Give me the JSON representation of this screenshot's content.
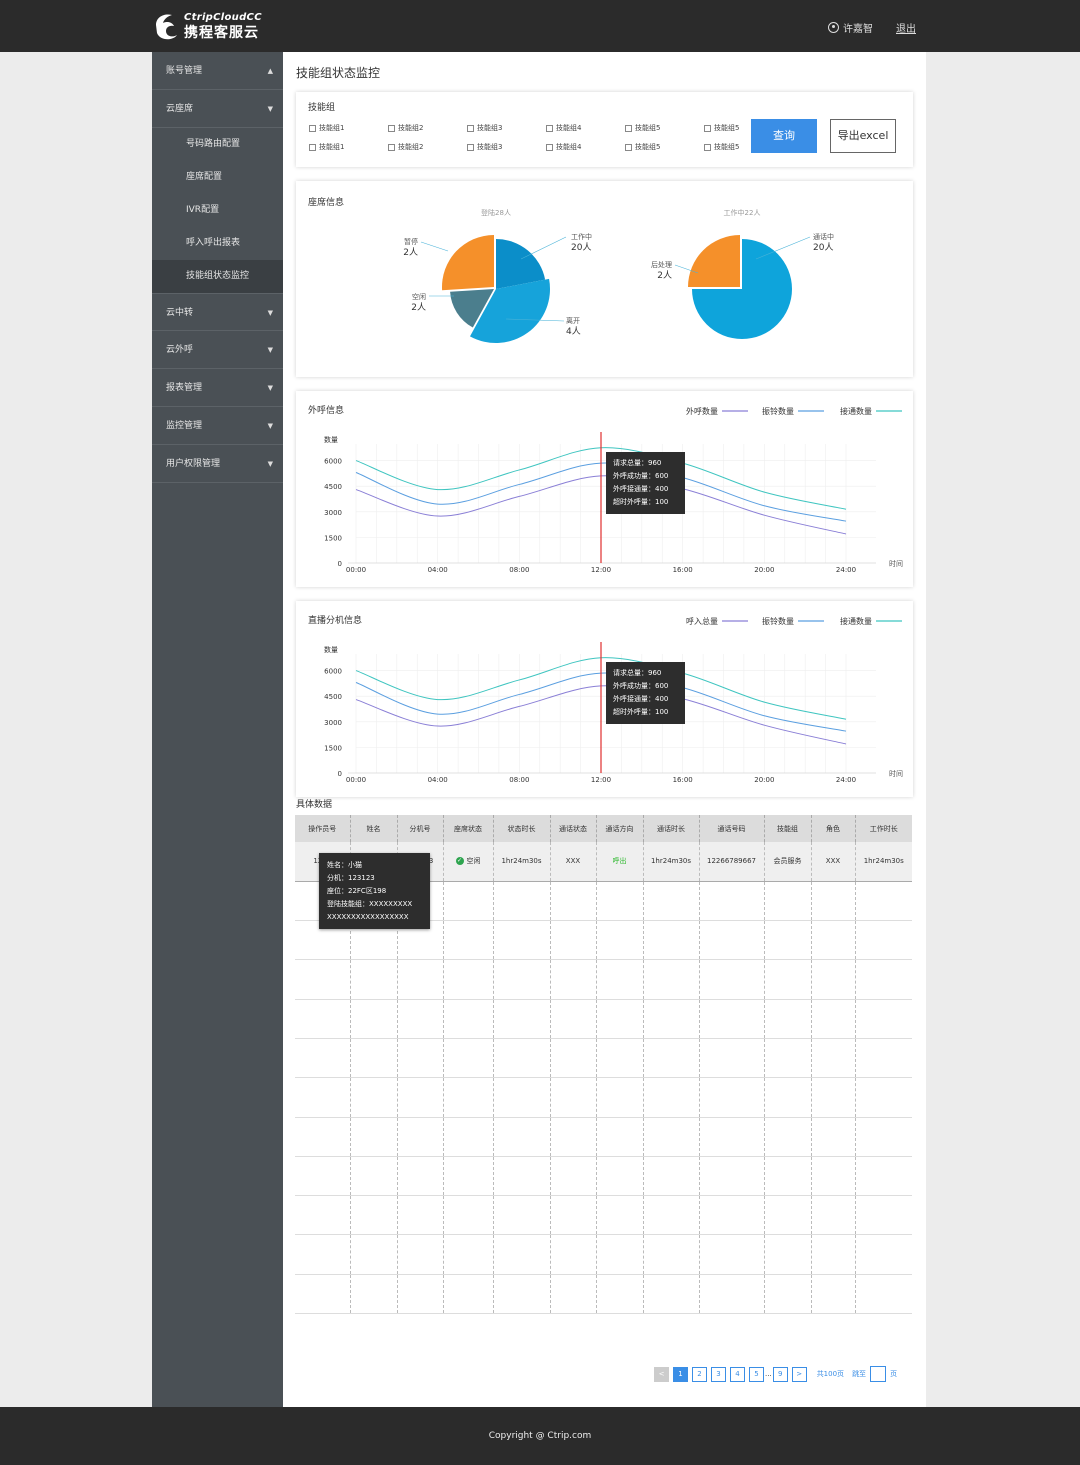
{
  "header": {
    "logo_en": "CtripCloudCC",
    "logo_cn": "携程客服云",
    "user_name": "许嘉智",
    "logout": "退出"
  },
  "sidebar": {
    "items": [
      {
        "label": "账号管理",
        "arrow": "▲"
      },
      {
        "label": "云座席",
        "arrow": "▼"
      },
      {
        "label": "云中转",
        "arrow": "▼"
      },
      {
        "label": "云外呼",
        "arrow": "▼"
      },
      {
        "label": "报表管理",
        "arrow": "▼"
      },
      {
        "label": "监控管理",
        "arrow": "▼"
      },
      {
        "label": "用户权限管理",
        "arrow": "▼"
      }
    ],
    "subitems": [
      "号码路由配置",
      "座席配置",
      "IVR配置",
      "呼入呼出报表",
      "技能组状态监控"
    ]
  },
  "page": {
    "title": "技能组状态监控"
  },
  "filter": {
    "title": "技能组",
    "row1": [
      "技能组1",
      "技能组2",
      "技能组3",
      "技能组4",
      "技能组5",
      "技能组5"
    ],
    "row2": [
      "技能组1",
      "技能组2",
      "技能组3",
      "技能组4",
      "技能组5",
      "技能组5"
    ],
    "query_label": "查询",
    "export_label": "导出excel"
  },
  "seat_info": {
    "title": "座席信息",
    "pie1": {
      "caption": "登陆28人",
      "slices": [
        {
          "label": "工作中",
          "count": "20人",
          "value": 20,
          "color": "#0b8ec9"
        },
        {
          "label": "离开",
          "count": "4人",
          "value": 4,
          "color": "#16a3da"
        },
        {
          "label": "空闲",
          "count": "2人",
          "value": 2,
          "color": "#4b7e8d"
        },
        {
          "label": "暂停",
          "count": "2人",
          "value": 2,
          "color": "#f5902a"
        }
      ]
    },
    "pie2": {
      "caption": "工作中22人",
      "slices": [
        {
          "label": "通话中",
          "count": "20人",
          "value": 20,
          "color": "#0ea4db"
        },
        {
          "label": "后处理",
          "count": "2人",
          "value": 2,
          "color": "#f5902a"
        }
      ]
    }
  },
  "chart_data": [
    {
      "type": "line",
      "title": "外呼信息",
      "ylabel": "数量",
      "xlabel": "时间",
      "x": [
        "00:00",
        "04:00",
        "08:00",
        "12:00",
        "16:00",
        "20:00",
        "24:00"
      ],
      "y_ticks": [
        0,
        1500,
        3000,
        4500,
        6000
      ],
      "ylim": [
        0,
        6500
      ],
      "legend_position": "top-right",
      "series": [
        {
          "name": "外呼数量",
          "color": "#8a7fd6",
          "values": [
            4300,
            2750,
            3900,
            5100,
            4350,
            2800,
            1700
          ]
        },
        {
          "name": "振铃数量",
          "color": "#5b9fe0",
          "values": [
            5300,
            3450,
            4600,
            5850,
            5000,
            3350,
            2450
          ]
        },
        {
          "name": "接通数量",
          "color": "#3fc5c0",
          "values": [
            6000,
            4300,
            5450,
            6750,
            5850,
            4150,
            3150
          ]
        }
      ],
      "marker_x": "12:00",
      "tooltip": [
        "请求总量：960",
        "外呼成功量：600",
        "外呼接通量：400",
        "超时外呼量：100"
      ]
    },
    {
      "type": "line",
      "title": "直播分机信息",
      "ylabel": "数量",
      "xlabel": "时间",
      "x": [
        "00:00",
        "04:00",
        "08:00",
        "12:00",
        "16:00",
        "20:00",
        "24:00"
      ],
      "y_ticks": [
        0,
        1500,
        3000,
        4500,
        6000
      ],
      "ylim": [
        0,
        6500
      ],
      "legend_position": "top-right",
      "series": [
        {
          "name": "呼入总量",
          "color": "#8a7fd6",
          "values": [
            4300,
            2750,
            3900,
            5100,
            4350,
            2800,
            1700
          ]
        },
        {
          "name": "振铃数量",
          "color": "#5b9fe0",
          "values": [
            5300,
            3450,
            4600,
            5850,
            5000,
            3350,
            2450
          ]
        },
        {
          "name": "接通数量",
          "color": "#3fc5c0",
          "values": [
            6000,
            4300,
            5450,
            6750,
            5850,
            4150,
            3150
          ]
        }
      ],
      "marker_x": "12:00",
      "tooltip": [
        "请求总量：960",
        "外呼成功量：600",
        "外呼接通量：400",
        "超时外呼量：100"
      ]
    }
  ],
  "table": {
    "title": "具体数据",
    "headers": [
      "操作员号",
      "姓名",
      "分机号",
      "座席状态",
      "状态时长",
      "通话状态",
      "通话方向",
      "通话时长",
      "通话号码",
      "技能组",
      "角色",
      "工作时长"
    ],
    "row": [
      "1231",
      "小猫",
      "100123",
      "空闲",
      "1hr24m30s",
      "XXX",
      "呼出",
      "1hr24m30s",
      "12266789667",
      "会员服务",
      "XXX",
      "1hr24m30s"
    ],
    "tooltip": [
      "姓名：小猫",
      "分机：123123",
      "座位：22FC区198",
      "登陆技能组：XXXXXXXXX",
      "XXXXXXXXXXXXXXXXX"
    ]
  },
  "pagination": {
    "pages": [
      "1",
      "2",
      "3",
      "4",
      "5",
      "9"
    ],
    "ellipsis": "...",
    "prev": "<",
    "next": ">",
    "total": "共100页",
    "jump": "跳至",
    "page_unit": "页"
  },
  "footer": {
    "copyright": "Copyright @ Ctrip.com"
  }
}
